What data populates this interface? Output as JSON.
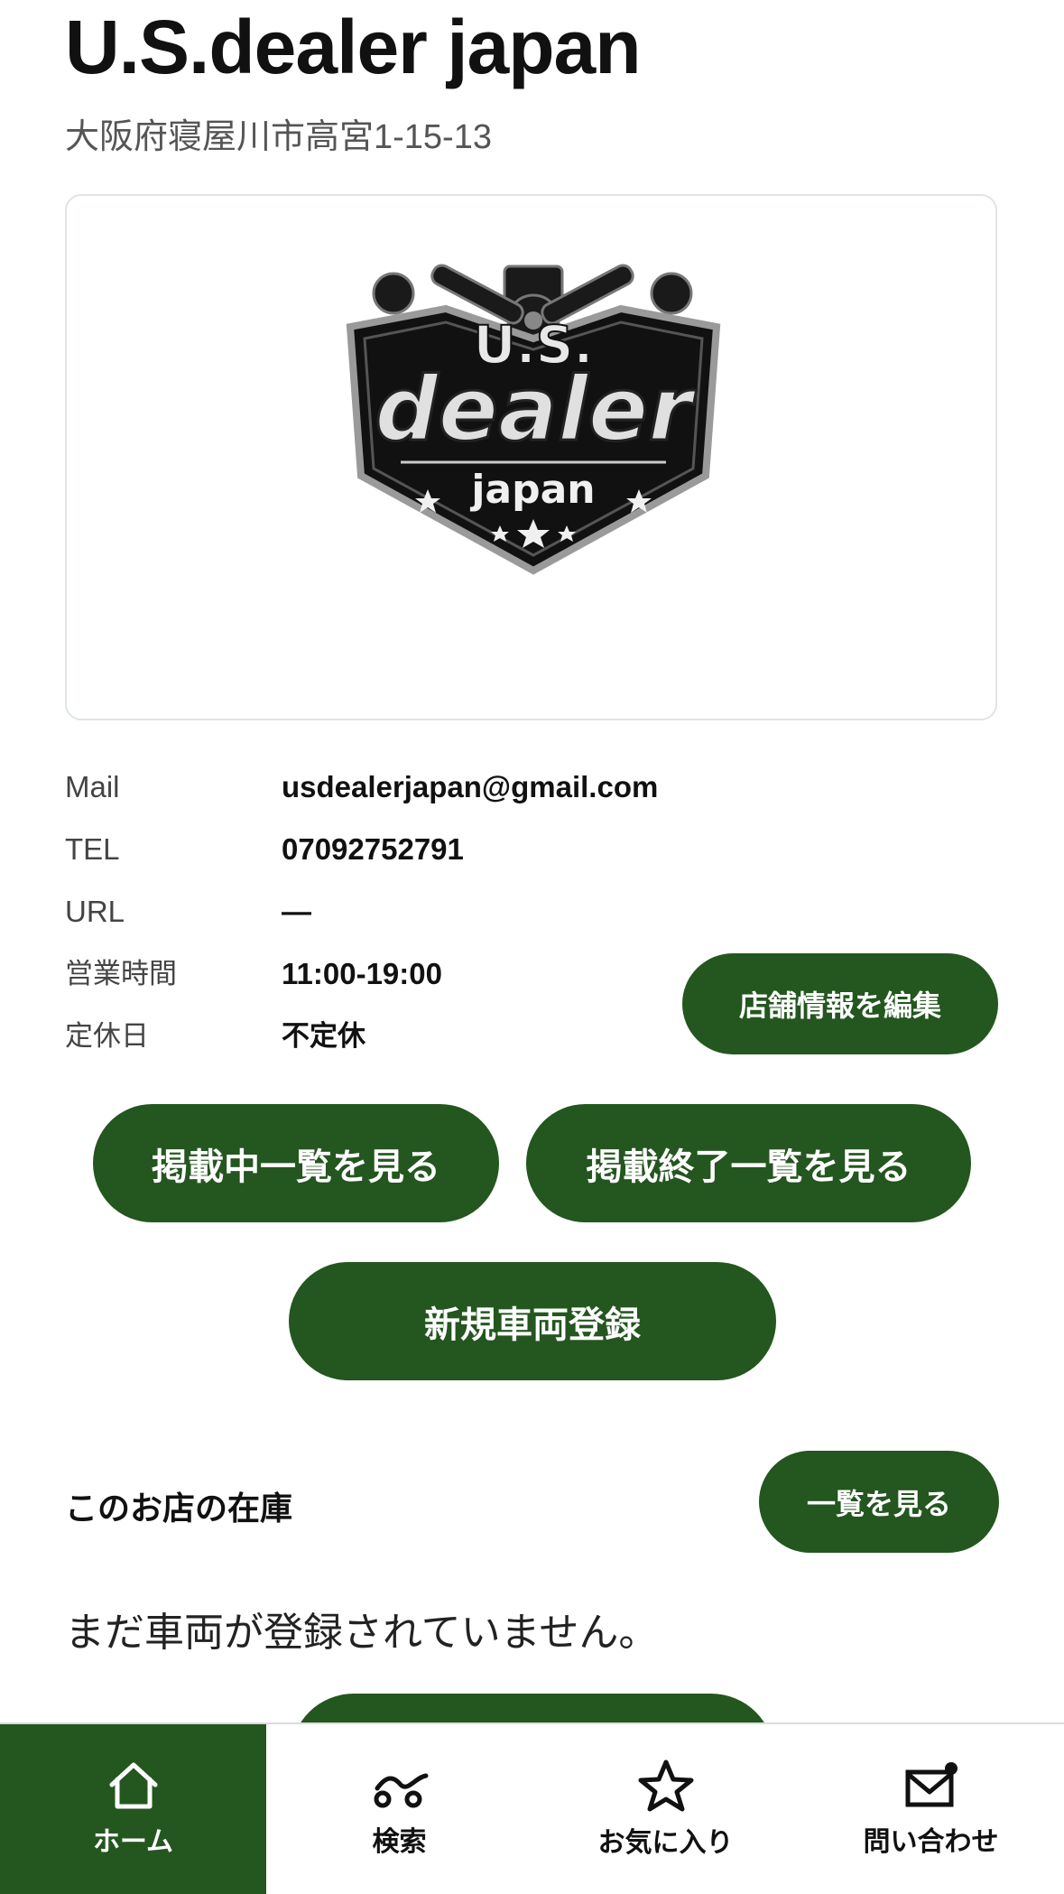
{
  "shop": {
    "name": "U.S.dealer japan",
    "address": "大阪府寝屋川市高宮1-15-13"
  },
  "logo": {
    "line1": "U.S.",
    "line2": "dealer",
    "line3": "japan"
  },
  "info": [
    {
      "label": "Mail",
      "value": "usdealerjapan@gmail.com"
    },
    {
      "label": "TEL",
      "value": "07092752791"
    },
    {
      "label": "URL",
      "value": "—"
    },
    {
      "label": "営業時間",
      "value": "11:00-19:00"
    },
    {
      "label": "定休日",
      "value": "不定休"
    }
  ],
  "buttons": {
    "edit_shop": "店舗情報を編集",
    "listed": "掲載中一覧を見る",
    "ended": "掲載終了一覧を見る",
    "new_vehicle": "新規車両登録",
    "view_list": "一覧を見る"
  },
  "inventory": {
    "title": "このお店の在庫",
    "empty": "まだ車両が登録されていません。"
  },
  "tabs": [
    {
      "label": "ホーム",
      "icon": "home-icon",
      "active": true
    },
    {
      "label": "検索",
      "icon": "search-car-icon",
      "active": false
    },
    {
      "label": "お気に入り",
      "icon": "star-icon",
      "active": false
    },
    {
      "label": "問い合わせ",
      "icon": "mail-icon",
      "active": false
    }
  ],
  "colors": {
    "accent": "#24561f"
  }
}
